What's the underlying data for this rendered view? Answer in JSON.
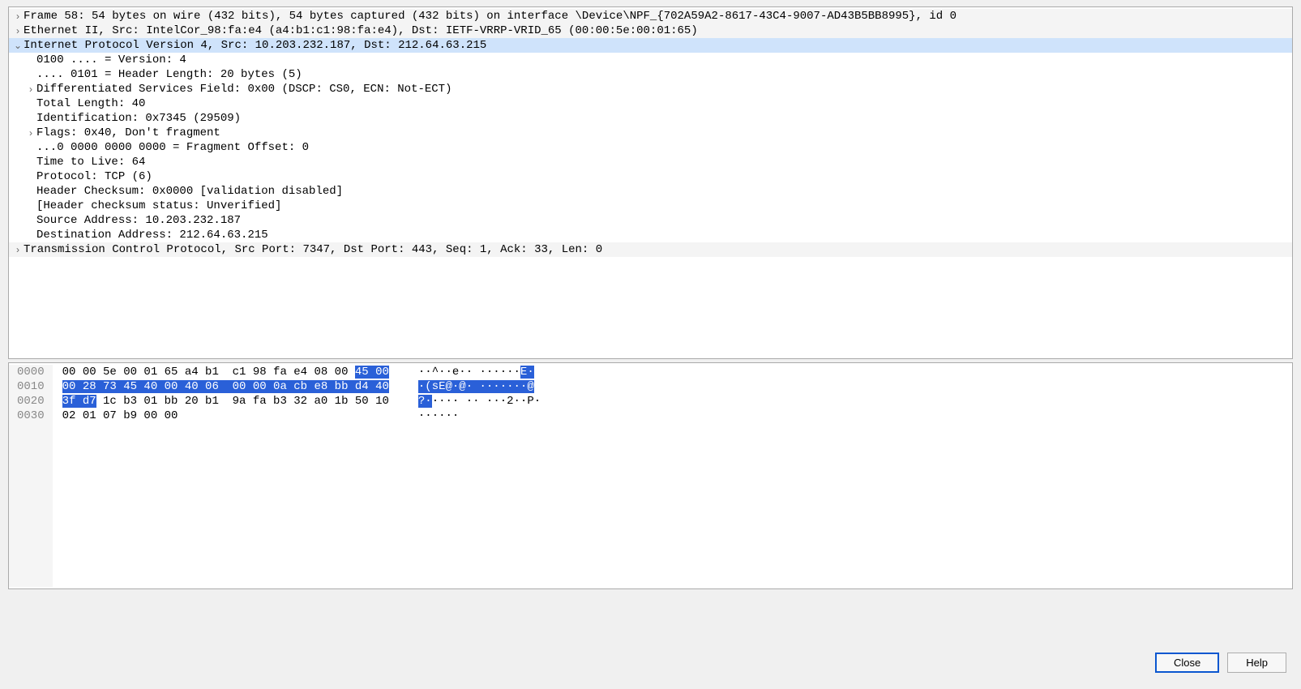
{
  "tree": {
    "frame": "Frame 58: 54 bytes on wire (432 bits), 54 bytes captured (432 bits) on interface \\Device\\NPF_{702A59A2-8617-43C4-9007-AD43B5BB8995}, id 0",
    "eth": "Ethernet II, Src: IntelCor_98:fa:e4 (a4:b1:c1:98:fa:e4), Dst: IETF-VRRP-VRID_65 (00:00:5e:00:01:65)",
    "ip": "Internet Protocol Version 4, Src: 10.203.232.187, Dst: 212.64.63.215",
    "ip_version": "0100 .... = Version: 4",
    "ip_hlen": ".... 0101 = Header Length: 20 bytes (5)",
    "ip_dsf": "Differentiated Services Field: 0x00 (DSCP: CS0, ECN: Not-ECT)",
    "ip_totlen": "Total Length: 40",
    "ip_id": "Identification: 0x7345 (29509)",
    "ip_flags": "Flags: 0x40, Don't fragment",
    "ip_fragoff": "...0 0000 0000 0000 = Fragment Offset: 0",
    "ip_ttl": "Time to Live: 64",
    "ip_proto": "Protocol: TCP (6)",
    "ip_cksum": "Header Checksum: 0x0000 [validation disabled]",
    "ip_cksum_status": "[Header checksum status: Unverified]",
    "ip_src": "Source Address: 10.203.232.187",
    "ip_dst": "Destination Address: 212.64.63.215",
    "tcp": "Transmission Control Protocol, Src Port: 7347, Dst Port: 443, Seq: 1, Ack: 33, Len: 0"
  },
  "bytes": {
    "offsets": [
      "0000",
      "0010",
      "0020",
      "0030"
    ],
    "row0": {
      "pre": "00 00 5e 00 01 65 a4 b1  c1 98 fa e4 08 00 ",
      "hl": "45 00",
      "post": ""
    },
    "row1": {
      "pre": "",
      "hl": "00 28 73 45 40 00 40 06  00 00 0a cb e8 bb d4 40",
      "post": ""
    },
    "row2": {
      "pre": "",
      "hl": "3f d7",
      "post": " 1c b3 01 bb 20 b1  9a fa b3 32 a0 1b 50 10"
    },
    "row3": {
      "pre": "02 01 07 b9 00 00",
      "hl": "",
      "post": ""
    },
    "arow0": {
      "pre": "··^··e·· ······",
      "hl": "E·",
      "post": ""
    },
    "arow1": {
      "pre": "",
      "hl": "·(sE@·@· ·······@",
      "post": ""
    },
    "arow2": {
      "pre": "",
      "hl": "?·",
      "post": "···· ·· ···2··P·"
    },
    "arow3": {
      "pre": "······",
      "hl": "",
      "post": ""
    }
  },
  "buttons": {
    "close": "Close",
    "help": "Help"
  }
}
